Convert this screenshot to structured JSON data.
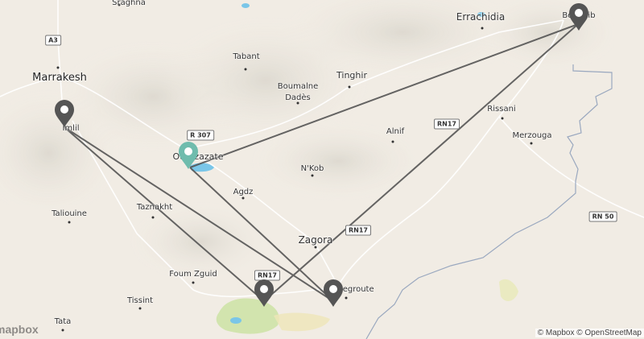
{
  "places": [
    {
      "id": "sraghna",
      "name": "Sraghna",
      "size": "small"
    },
    {
      "id": "errachidia",
      "name": "Errachidia",
      "size": "small"
    },
    {
      "id": "boudnib",
      "name": "Boudnib",
      "size": "small"
    },
    {
      "id": "marrakesh",
      "name": "Marrakesh",
      "size": "big"
    },
    {
      "id": "tabant",
      "name": "Tabant",
      "size": "small"
    },
    {
      "id": "tinghir",
      "name": "Tinghir",
      "size": "small"
    },
    {
      "id": "boumalne",
      "name": "Boumalne\nDadès",
      "size": "small"
    },
    {
      "id": "imlil",
      "name": "Imlil",
      "size": "small"
    },
    {
      "id": "rissani",
      "name": "Rissani",
      "size": "small"
    },
    {
      "id": "alnif",
      "name": "Alnif",
      "size": "small"
    },
    {
      "id": "merzouga",
      "name": "Merzouga",
      "size": "small"
    },
    {
      "id": "ouarzazate",
      "name": "Ouarzazate",
      "size": "small"
    },
    {
      "id": "nkob",
      "name": "N'Kob",
      "size": "small"
    },
    {
      "id": "agdz",
      "name": "Agdz",
      "size": "small"
    },
    {
      "id": "taliouine",
      "name": "Taliouine",
      "size": "small"
    },
    {
      "id": "taznakht",
      "name": "Taznakht",
      "size": "small"
    },
    {
      "id": "zagora",
      "name": "Zagora",
      "size": "small"
    },
    {
      "id": "foum_zguid",
      "name": "Foum Zguid",
      "size": "small"
    },
    {
      "id": "tamegroute",
      "name": "Tamegroute",
      "size": "small"
    },
    {
      "id": "tissint",
      "name": "Tissint",
      "size": "small"
    },
    {
      "id": "tata",
      "name": "Tata",
      "size": "small"
    }
  ],
  "roads": [
    {
      "id": "a3",
      "label": "A3"
    },
    {
      "id": "r307",
      "label": "R 307"
    },
    {
      "id": "rn17_a",
      "label": "RN17"
    },
    {
      "id": "rn17_b",
      "label": "RN17"
    },
    {
      "id": "rn17_c",
      "label": "RN17"
    },
    {
      "id": "rn50",
      "label": "RN 50"
    }
  ],
  "markers": [
    {
      "id": "imlil",
      "color": "#555555"
    },
    {
      "id": "ouarzazate",
      "color": "#6fbcad"
    },
    {
      "id": "boudnib",
      "color": "#555555"
    },
    {
      "id": "foum_zguid_camp",
      "color": "#555555"
    },
    {
      "id": "tamegroute",
      "color": "#555555"
    }
  ],
  "route_color": "#555555",
  "attribution": "© Mapbox © OpenStreetMap",
  "logo": "mapbox"
}
